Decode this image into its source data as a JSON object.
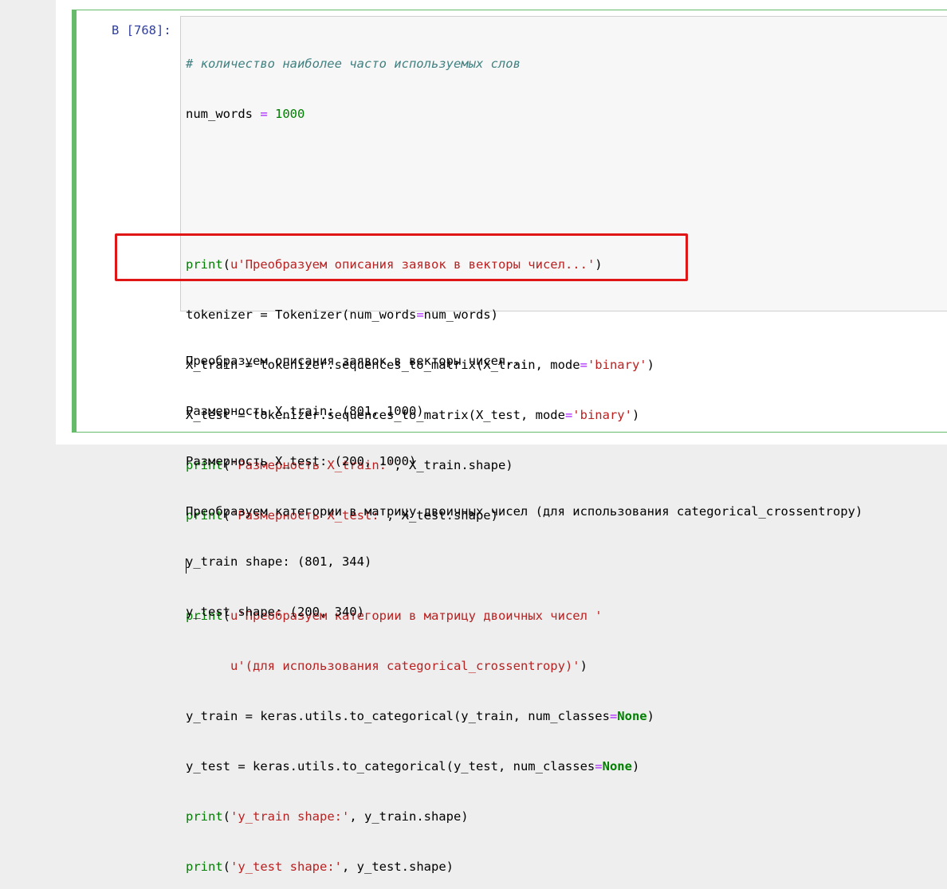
{
  "cell": {
    "prompt": "В [768]:",
    "code": {
      "comment": "# количество наиболее часто используемых слов",
      "num_words_var": "num_words",
      "eq": " = ",
      "num_words_val": "1000",
      "print": "print",
      "u": "u",
      "s_vectors": "'Преобразуем описания заявок в векторы чисел...'",
      "tok_var": "tokenizer",
      "tok_call_a": "Tokenizer(num_words",
      "tok_call_b": "=",
      "tok_call_c": "num_words)",
      "xtrain_var": "X_train",
      "xtrain_call": "tokenizer.sequences_to_matrix(X_train, mode",
      "binary": "'binary'",
      "xtest_var": "X_test",
      "xtest_call": "tokenizer.sequences_to_matrix(X_test, mode",
      "s_dim_train": "'Размерность X_train:'",
      "xtrain_shape": ", X_train.shape)",
      "s_dim_test": "'Размерность X_test:'",
      "xtest_shape": ", X_test.shape)",
      "s_cat1": "'Преобразуем категории в матрицу двоичных чисел '",
      "s_cat2": "'(для использования categorical_crossentropy)'",
      "ytrain_var": "y_train",
      "ytrain_call": "keras.utils.to_categorical(y_train, num_classes",
      "none": "None",
      "ytest_var": "y_test",
      "ytest_call": "keras.utils.to_categorical(y_test, num_classes",
      "s_ytrain_shape": "'y_train shape:'",
      "ytrain_shape": ", y_train.shape)",
      "s_ytest_shape": "'y_test shape:'",
      "ytest_shape": ", y_test.shape)"
    },
    "output": [
      "Преобразуем описания заявок в векторы чисел...",
      "Размерность X_train: (801, 1000)",
      "Размерность X_test: (200, 1000)",
      "Преобразуем категории в матрицу двоичных чисел (для использования categorical_crossentropy)",
      "y_train shape: (801, 344)",
      "y_test shape: (200, 340)"
    ]
  },
  "colors": {
    "active_cell": "#66bb6a",
    "highlight": "#e01515",
    "prompt": "#303f9f",
    "string": "#ba2121",
    "builtin": "#008000"
  }
}
